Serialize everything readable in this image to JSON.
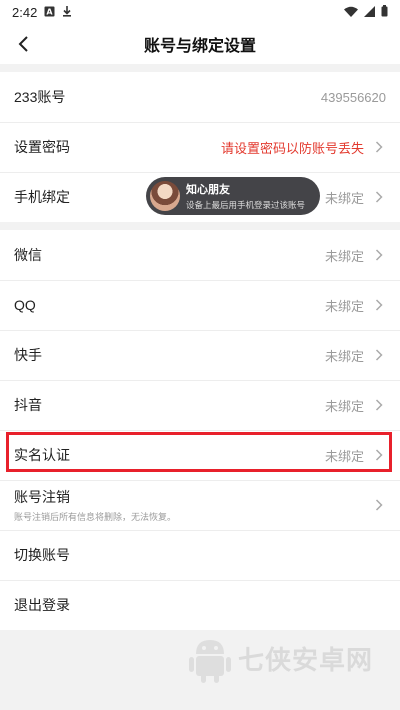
{
  "status_bar": {
    "time": "2:42"
  },
  "header": {
    "title": "账号与绑定设置"
  },
  "groups": [
    {
      "rows": [
        {
          "label": "233账号",
          "value": "439556620"
        },
        {
          "label": "设置密码",
          "value": "请设置密码以防账号丢失"
        },
        {
          "label": "手机绑定",
          "value": "未绑定"
        }
      ]
    },
    {
      "rows": [
        {
          "label": "微信",
          "value": "未绑定"
        },
        {
          "label": "QQ",
          "value": "未绑定"
        },
        {
          "label": "快手",
          "value": "未绑定"
        },
        {
          "label": "抖音",
          "value": "未绑定"
        },
        {
          "label": "实名认证",
          "value": "未绑定"
        },
        {
          "label": "账号注销",
          "sub": "账号注销后所有信息将删除，无法恢复。"
        },
        {
          "label": "切换账号"
        },
        {
          "label": "退出登录"
        }
      ]
    }
  ],
  "toast": {
    "name": "知心朋友",
    "message": "设备上最后用手机登录过该账号"
  },
  "watermark": {
    "text": "七侠安卓网"
  },
  "colors": {
    "warning_text": "#e33a2f",
    "highlight_border": "#e8202b"
  }
}
